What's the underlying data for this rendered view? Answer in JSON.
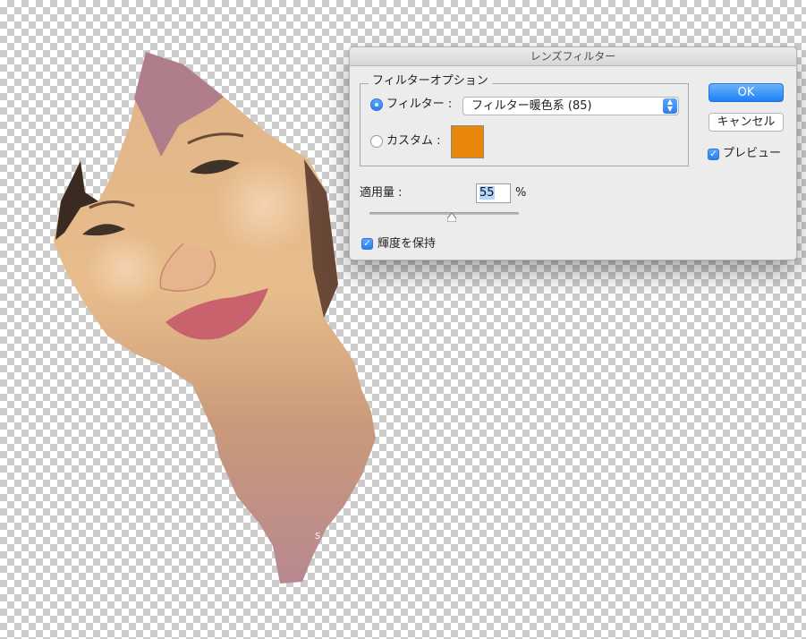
{
  "dialog": {
    "title": "レンズフィルター",
    "group_title": "フィルターオプション",
    "filter_label": "フィルター :",
    "filter_value": "フィルター暖色系 (85)",
    "custom_label": "カスタム :",
    "custom_color": "#e8870a",
    "density_label": "適用量 :",
    "density_value": "55",
    "density_unit": "%",
    "density_fraction": 0.55,
    "preserve_label": "輝度を保持",
    "ok_label": "OK",
    "cancel_label": "キャンセル",
    "preview_label": "プレビュー",
    "check_glyph": "✓",
    "select_arrows": "▲▼"
  },
  "icons": {
    "filter_radio": "radio-selected-icon",
    "custom_radio": "radio-unselected-icon",
    "preview_check": "checkbox-checked-icon",
    "preserve_check": "checkbox-checked-icon",
    "slider_thumb": "slider-thumb-icon",
    "select_arrows": "select-arrows-icon"
  },
  "colors": {
    "accent": "#2a7ff0",
    "dialog_bg": "#ececec"
  }
}
